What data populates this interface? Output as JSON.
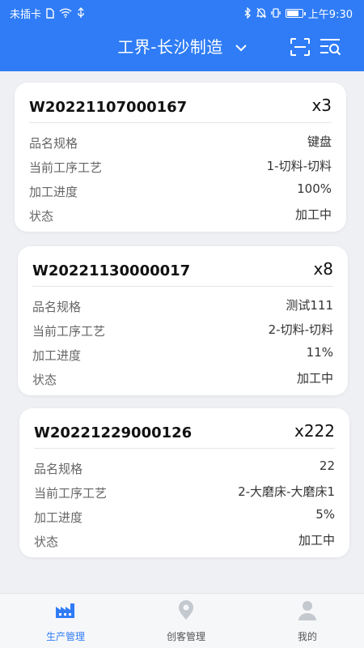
{
  "status_bar": {
    "carrier": "未插卡",
    "time": "上午9:30"
  },
  "header": {
    "title": "工界-长沙制造"
  },
  "orders": [
    {
      "order_no": "W20221107000167",
      "qty": "x3",
      "fields": [
        {
          "label": "品名规格",
          "value": "键盘"
        },
        {
          "label": "当前工序工艺",
          "value": "1-切料-切料"
        },
        {
          "label": "加工进度",
          "value": "100%"
        },
        {
          "label": "状态",
          "value": "加工中"
        }
      ]
    },
    {
      "order_no": "W20221130000017",
      "qty": "x8",
      "fields": [
        {
          "label": "品名规格",
          "value": "测试111"
        },
        {
          "label": "当前工序工艺",
          "value": "2-切料-切料"
        },
        {
          "label": "加工进度",
          "value": "11%"
        },
        {
          "label": "状态",
          "value": "加工中"
        }
      ]
    },
    {
      "order_no": "W20221229000126",
      "qty": "x222",
      "fields": [
        {
          "label": "品名规格",
          "value": "22"
        },
        {
          "label": "当前工序工艺",
          "value": "2-大磨床-大磨床1"
        },
        {
          "label": "加工进度",
          "value": "5%"
        },
        {
          "label": "状态",
          "value": "加工中"
        }
      ]
    }
  ],
  "tabs": [
    {
      "label": "生产管理",
      "icon": "factory-icon",
      "active": true
    },
    {
      "label": "创客管理",
      "icon": "location-pin-icon",
      "active": false
    },
    {
      "label": "我的",
      "icon": "person-icon",
      "active": false
    }
  ],
  "colors": {
    "primary": "#2f7cf6",
    "background": "#eef0f4",
    "inactive_icon": "#c4c8cf"
  }
}
